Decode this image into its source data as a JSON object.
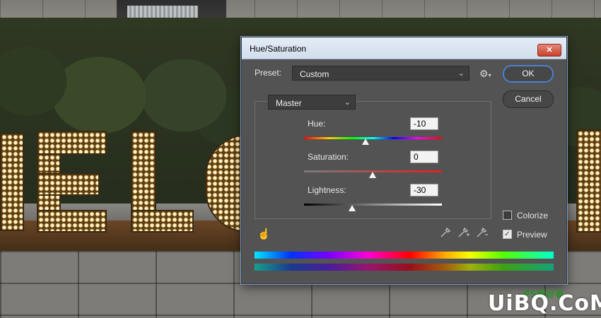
{
  "dialog": {
    "title": "Hue/Saturation",
    "close_label": "✕",
    "preset": {
      "label": "Preset:",
      "value": "Custom"
    },
    "channel": {
      "value": "Master"
    },
    "buttons": {
      "ok": "OK",
      "cancel": "Cancel"
    },
    "sliders": {
      "hue": {
        "label": "Hue:",
        "value": "-10",
        "range": [
          -180,
          180
        ]
      },
      "saturation": {
        "label": "Saturation:",
        "value": "0",
        "range": [
          -100,
          100
        ]
      },
      "lightness": {
        "label": "Lightness:",
        "value": "-30",
        "range": [
          -100,
          100
        ]
      }
    },
    "options": {
      "colorize": {
        "label": "Colorize",
        "checked": false
      },
      "preview": {
        "label": "Preview",
        "checked": true
      }
    },
    "colors": {
      "ok_border": "#4b7fd1",
      "panel": "#535353",
      "close": "#c8402c"
    }
  },
  "icons": {
    "gear": "gear-icon",
    "hand": "targeted-adjustment-hand-icon",
    "eyedropper": "eyedropper-icon",
    "eyedropper_plus": "eyedropper-add-icon",
    "eyedropper_minus": "eyedropper-subtract-icon"
  },
  "watermark": {
    "text": "UiBQ.CoM",
    "logo": "PS爱好者"
  }
}
